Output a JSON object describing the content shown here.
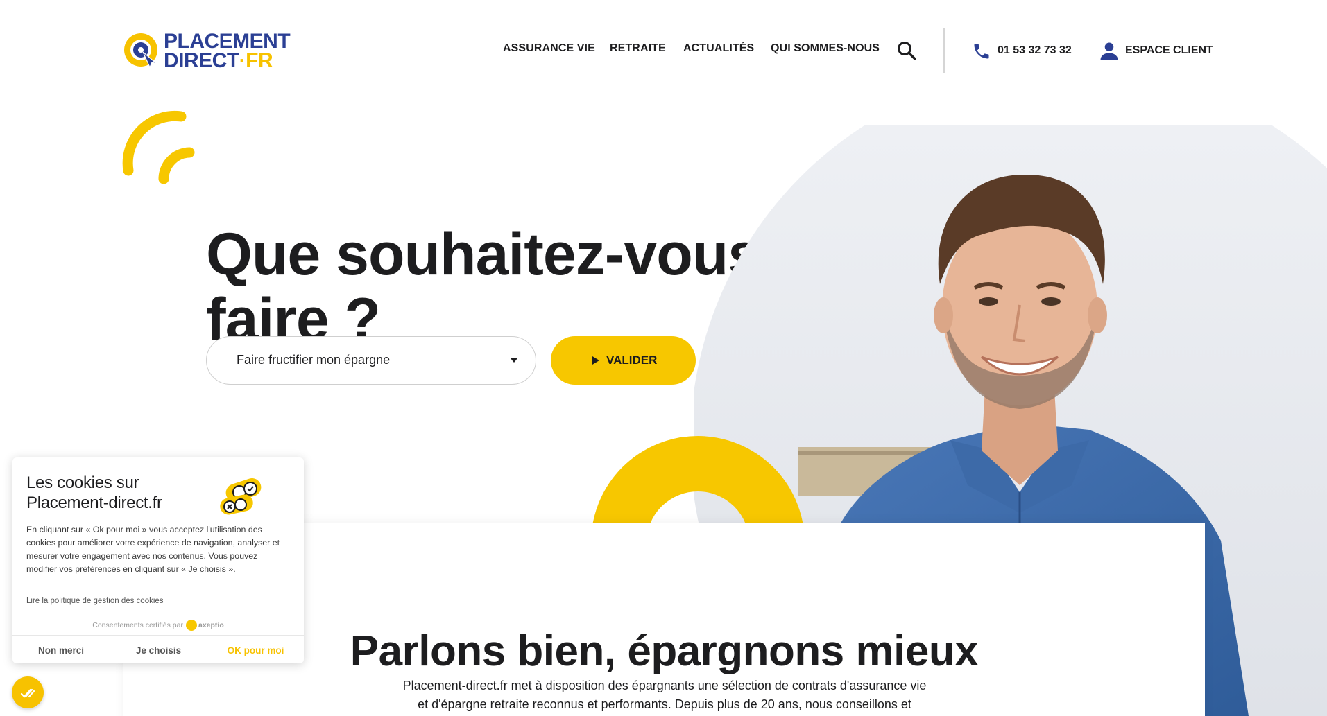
{
  "colors": {
    "brand_blue": "#2b3f94",
    "accent_yellow": "#f7c700",
    "text_dark": "#1d1d1f"
  },
  "logo": {
    "line1": "PLACEMENT",
    "line2_main": "DIRECT",
    "line2_sep": "·",
    "line2_tld": "FR"
  },
  "nav": {
    "items": [
      {
        "label": "ASSURANCE VIE"
      },
      {
        "label": "RETRAITE"
      },
      {
        "label": "ACTUALITÉS"
      },
      {
        "label": "QUI SOMMES-NOUS"
      }
    ],
    "search_icon": "search-icon",
    "phone_icon": "phone-icon",
    "phone_number": "01 53 32 73 32",
    "user_icon": "user-icon",
    "espace_client": "ESPACE CLIENT"
  },
  "hero": {
    "title": "Que souhaitez-vous faire ?",
    "select_value": "Faire fructifier mon épargne",
    "button_label": "VALIDER"
  },
  "section": {
    "title": "Parlons bien, épargnons mieux",
    "text": "Placement-direct.fr met à disposition des épargnants une sélection de contrats d'assurance vie et d'épargne retraite reconnus et performants. Depuis plus de 20 ans, nous conseillons et accompagnons nos clients vers les meilleurs placements en accord avec leurs objectifs."
  },
  "cookie": {
    "title": "Les cookies sur Placement-direct.fr",
    "text": "En cliquant sur « Ok pour moi » vous acceptez l'utilisation des cookies pour améliorer votre expérience de navigation, analyser et mesurer votre engagement avec nos contenus. Vous pouvez modifier vos préférences en cliquant sur « Je choisis ».",
    "policy_link": "Lire la politique de gestion des cookies",
    "certified": "Consentements certifiés par",
    "certified_brand": "axeptio",
    "btn_refuse": "Non merci",
    "btn_choose": "Je choisis",
    "btn_accept": "OK pour moi"
  }
}
